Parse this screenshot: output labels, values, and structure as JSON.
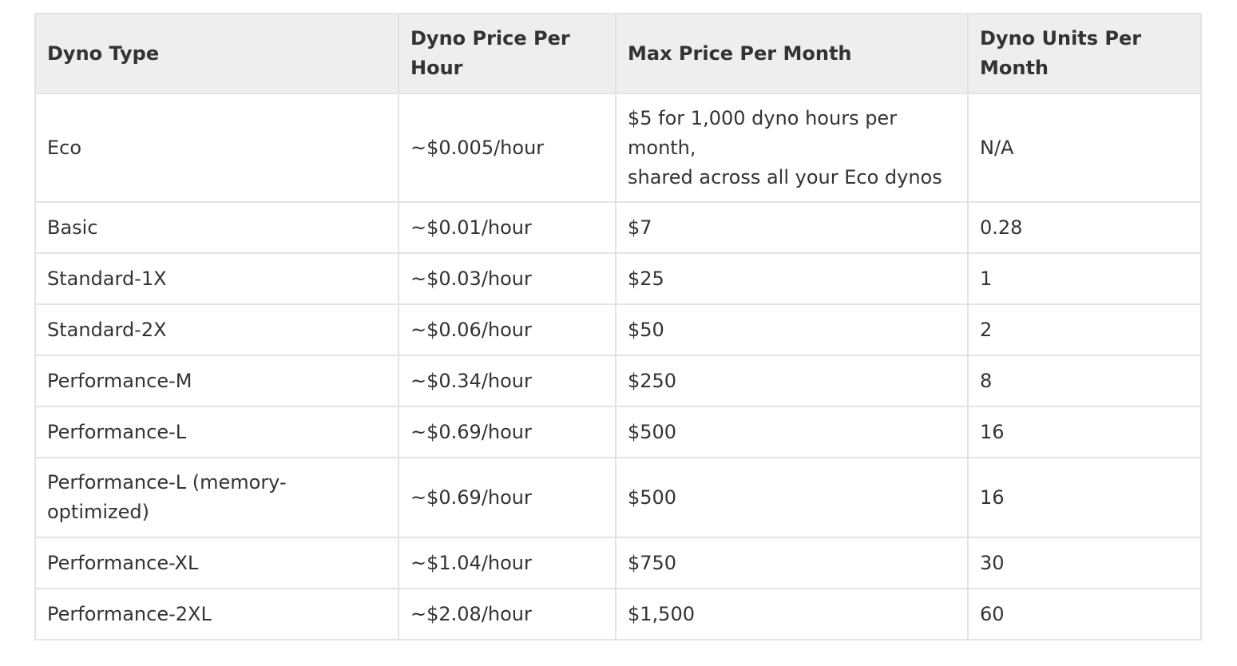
{
  "table": {
    "headers": [
      "Dyno Type",
      "Dyno Price Per Hour",
      "Max Price Per Month",
      "Dyno Units Per Month"
    ],
    "rows": [
      {
        "type": "Eco",
        "price_hour": "~$0.005/hour",
        "max_month": "$5 for 1,000 dyno hours per month,\nshared across all your Eco dynos",
        "units": "N/A"
      },
      {
        "type": "Basic",
        "price_hour": "~$0.01/hour",
        "max_month": "$7",
        "units": "0.28"
      },
      {
        "type": "Standard-1X",
        "price_hour": "~$0.03/hour",
        "max_month": "$25",
        "units": "1"
      },
      {
        "type": "Standard-2X",
        "price_hour": "~$0.06/hour",
        "max_month": "$50",
        "units": "2"
      },
      {
        "type": "Performance-M",
        "price_hour": "~$0.34/hour",
        "max_month": "$250",
        "units": "8"
      },
      {
        "type": "Performance-L",
        "price_hour": "~$0.69/hour",
        "max_month": "$500",
        "units": "16"
      },
      {
        "type": "Performance-L (memory-optimized)",
        "price_hour": "~$0.69/hour",
        "max_month": "$500",
        "units": "16"
      },
      {
        "type": "Performance-XL",
        "price_hour": "~$1.04/hour",
        "max_month": "$750",
        "units": "30"
      },
      {
        "type": "Performance-2XL",
        "price_hour": "~$2.08/hour",
        "max_month": "$1,500",
        "units": "60"
      }
    ]
  }
}
